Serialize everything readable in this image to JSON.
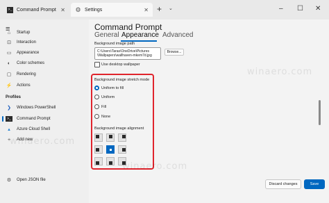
{
  "tabs": [
    {
      "label": "Command Prompt",
      "icon": "terminal-icon"
    },
    {
      "label": "Settings",
      "icon": "gear-icon"
    }
  ],
  "sidebar": {
    "items": [
      {
        "label": "Startup",
        "icon": "startup-icon"
      },
      {
        "label": "Interaction",
        "icon": "interaction-icon"
      },
      {
        "label": "Appearance",
        "icon": "appearance-icon"
      },
      {
        "label": "Color schemes",
        "icon": "color-schemes-icon"
      },
      {
        "label": "Rendering",
        "icon": "rendering-icon"
      },
      {
        "label": "Actions",
        "icon": "actions-icon"
      }
    ],
    "profiles_header": "Profiles",
    "profiles": [
      {
        "label": "Windows PowerShell",
        "icon": "powershell-icon"
      },
      {
        "label": "Command Prompt",
        "icon": "terminal-icon"
      },
      {
        "label": "Azure Cloud Shell",
        "icon": "azure-icon"
      },
      {
        "label": "Add new",
        "icon": "plus-icon"
      }
    ],
    "open_json": "Open JSON file"
  },
  "main": {
    "title": "Command Prompt",
    "pivots": [
      "General",
      "Appearance",
      "Advanced"
    ],
    "selected_pivot": "Appearance",
    "bg_image_path_label": "Background image path",
    "bg_image_path_line1": "C:\\Users\\Taras\\OneDrive\\Pictures",
    "bg_image_path_line2": "\\Wallpapers\\wallhaven-mkem7d.jpg",
    "browse_label": "Browse...",
    "use_desktop_wallpaper": "Use desktop wallpaper",
    "stretch_mode_label": "Background image stretch mode",
    "stretch_options": [
      "Uniform to fill",
      "Uniform",
      "Fill",
      "None"
    ],
    "selected_stretch": "Uniform to fill",
    "alignment_label": "Background image alignment",
    "selected_alignment": "center"
  },
  "watermark": "winaero.com",
  "footer": {
    "discard_label": "Discard changes",
    "save_label": "Save"
  },
  "colors": {
    "accent": "#0067c0",
    "highlight": "#e0242c"
  }
}
